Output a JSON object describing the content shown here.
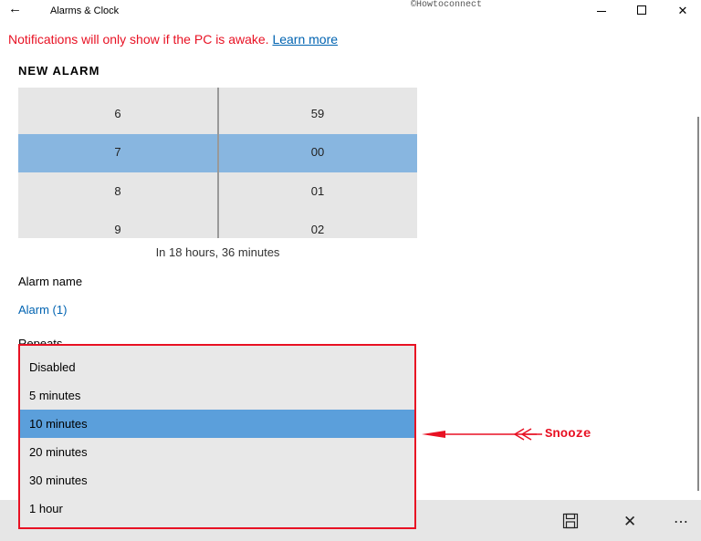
{
  "titlebar": {
    "back_icon": "back-arrow-icon",
    "title": "Alarms & Clock",
    "watermark": "©Howtoconnect",
    "minimize_icon": "minimize-icon",
    "maximize_icon": "maximize-icon",
    "close_icon": "close-icon"
  },
  "notice": {
    "text": "Notifications will only show if the PC is awake.",
    "link": "Learn more"
  },
  "section_title": "NEW ALARM",
  "time_picker": {
    "hours": [
      "6",
      "7",
      "8",
      "9"
    ],
    "minutes": [
      "59",
      "00",
      "01",
      "02"
    ],
    "selected_hour": "7",
    "selected_minute": "00",
    "selection_color": "#88b6e0"
  },
  "until_text": "In 18 hours, 36 minutes",
  "alarm_name": {
    "label": "Alarm name",
    "value": "Alarm (1)"
  },
  "repeats_label": "Repeats",
  "snooze_dropdown": {
    "options": [
      "Disabled",
      "5 minutes",
      "10 minutes",
      "20 minutes",
      "30 minutes",
      "1 hour"
    ],
    "selected": "10 minutes",
    "highlight_color": "#5b9fdb",
    "outline_color": "#e81123"
  },
  "annotation": {
    "text": "Snooze",
    "color": "#e81123"
  },
  "commandbar": {
    "save_icon": "save-icon",
    "cancel_icon": "cancel-icon",
    "more_icon": "more-icon"
  }
}
